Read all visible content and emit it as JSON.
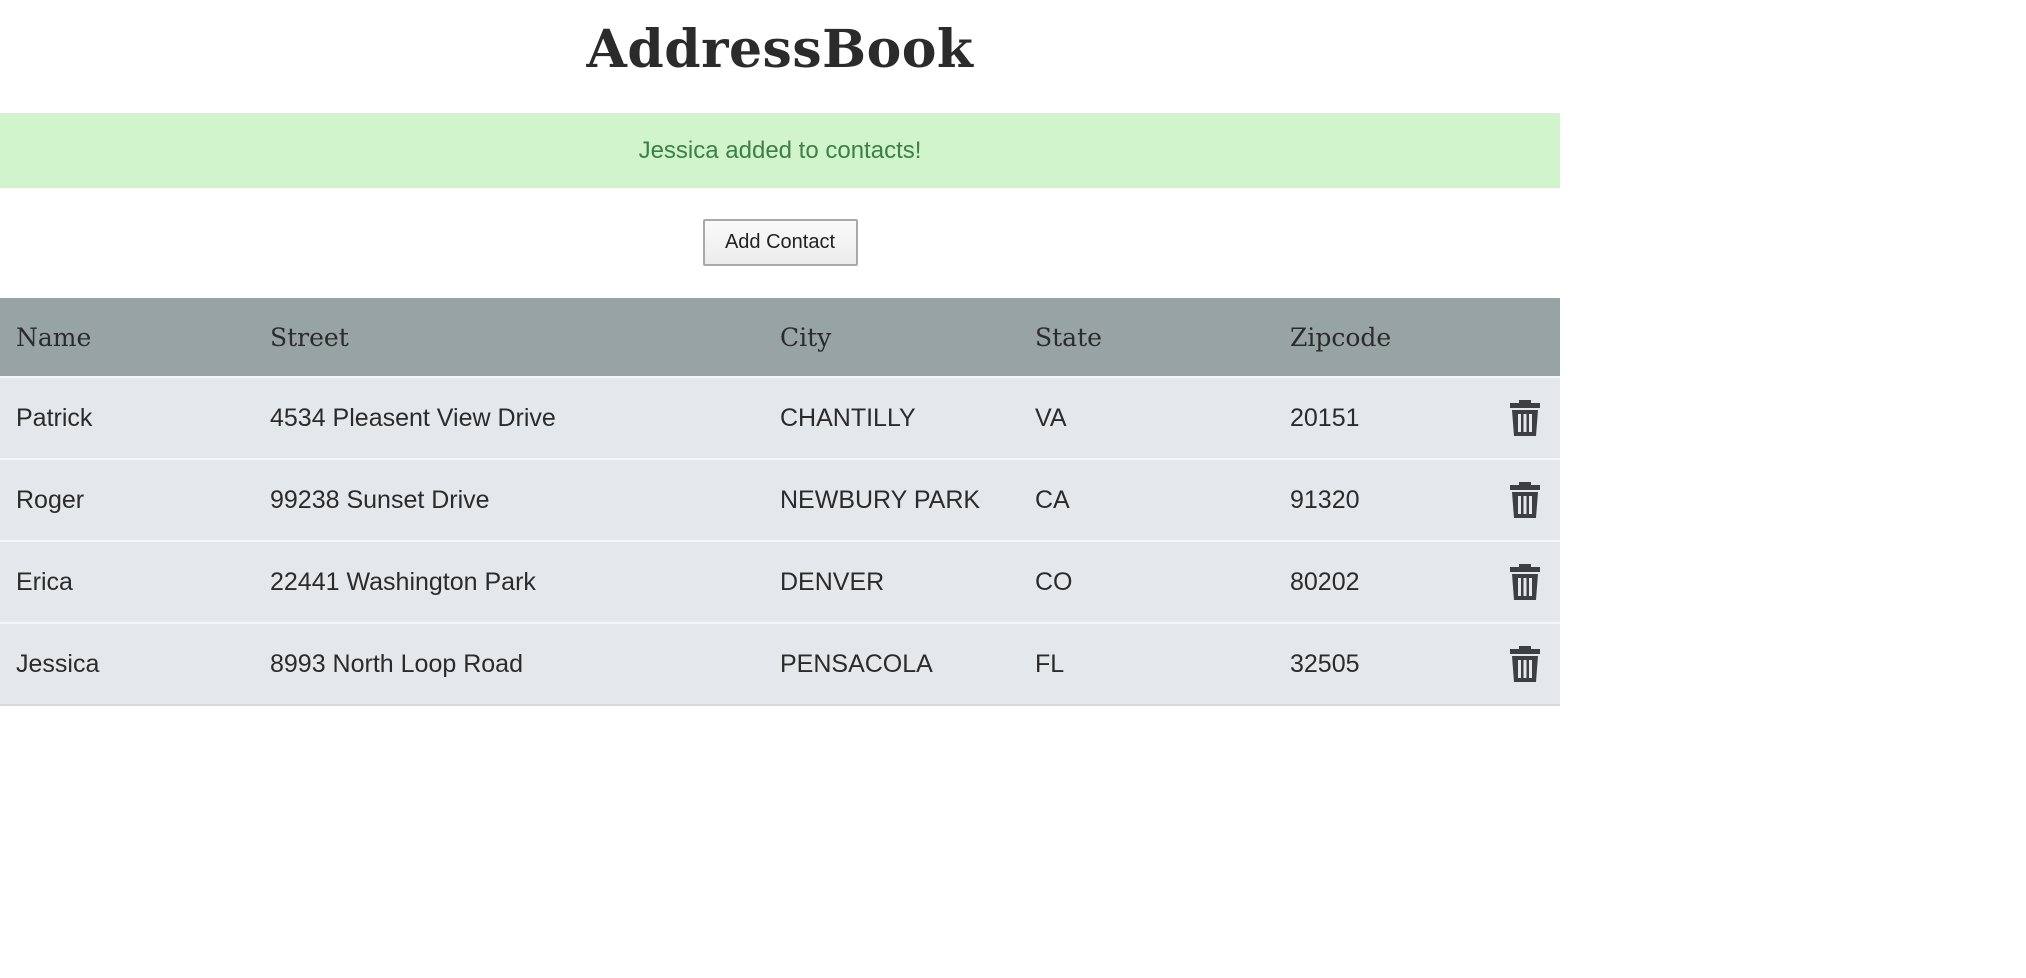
{
  "app": {
    "title": "AddressBook"
  },
  "alert": {
    "message": "Jessica added to contacts!",
    "background_color": "#d1f4cc",
    "text_color": "#3b8046"
  },
  "toolbar": {
    "add_contact_label": "Add Contact"
  },
  "table": {
    "header_color": "#98a3a4",
    "row_color": "#e4e8eb",
    "columns": [
      "Name",
      "Street",
      "City",
      "State",
      "Zipcode"
    ],
    "rows": [
      {
        "name": "Patrick",
        "street": "4534 Pleasent View Drive",
        "city": "CHANTILLY",
        "state": "VA",
        "zipcode": "20151",
        "action_icon": "trash-icon"
      },
      {
        "name": "Roger",
        "street": "99238 Sunset Drive",
        "city": "NEWBURY PARK",
        "state": "CA",
        "zipcode": "91320",
        "action_icon": "trash-icon"
      },
      {
        "name": "Erica",
        "street": "22441 Washington Park",
        "city": "DENVER",
        "state": "CO",
        "zipcode": "80202",
        "action_icon": "trash-icon"
      },
      {
        "name": "Jessica",
        "street": "8993 North Loop Road",
        "city": "PENSACOLA",
        "state": "FL",
        "zipcode": "32505",
        "action_icon": "trash-icon"
      }
    ]
  }
}
